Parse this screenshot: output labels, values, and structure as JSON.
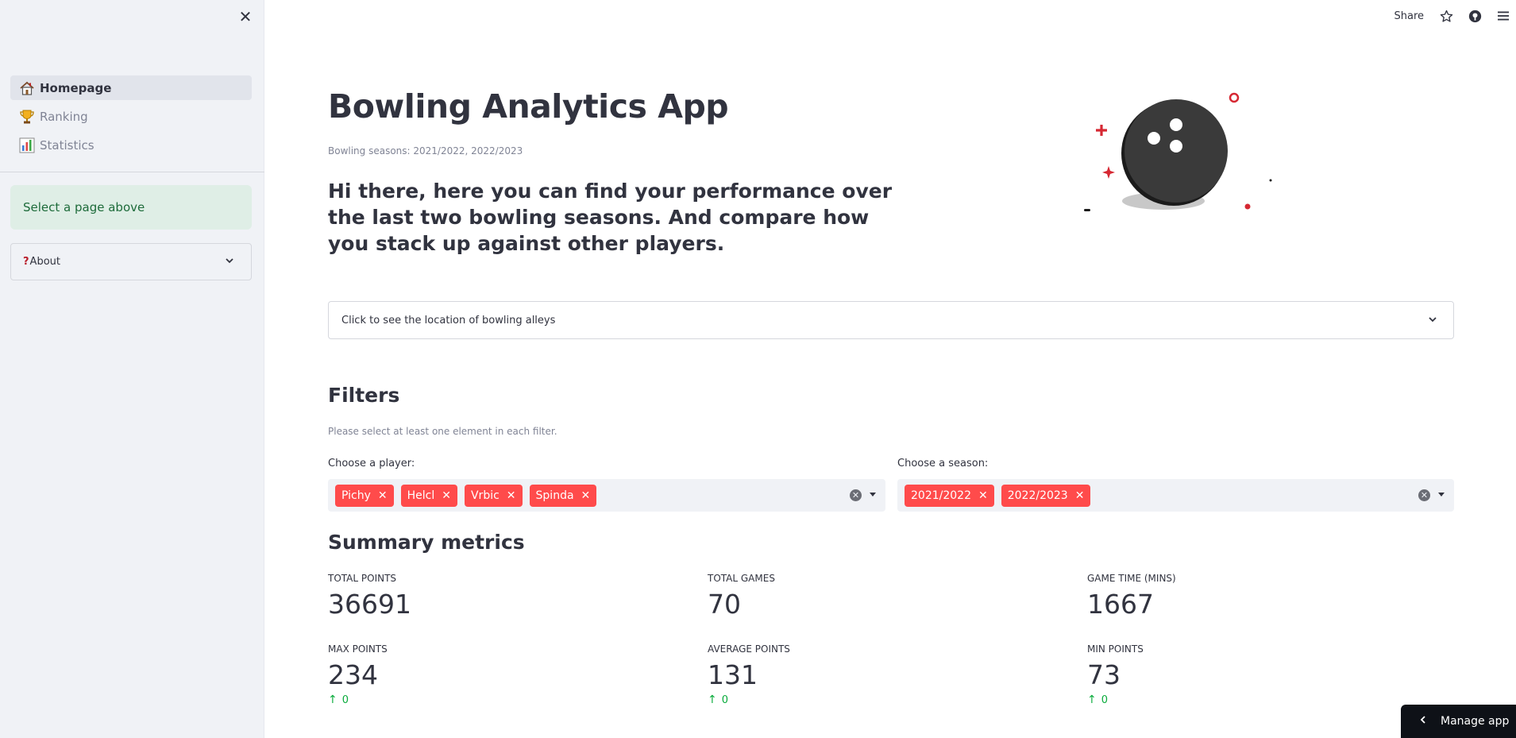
{
  "sidebar": {
    "items": [
      {
        "label": "Homepage",
        "icon": "house-icon"
      },
      {
        "label": "Ranking",
        "icon": "trophy-icon"
      },
      {
        "label": "Statistics",
        "icon": "bar-chart-icon"
      }
    ],
    "info": "Select a page above",
    "about_label": "About"
  },
  "toolbar": {
    "share_label": "Share"
  },
  "main": {
    "title": "Bowling Analytics App",
    "caption": "Bowling seasons: 2021/2022, 2022/2023",
    "intro": "Hi there, here you can find your performance over the last two bowling seasons. And compare how you stack up against other players.",
    "expander_label": "Click to see the location of bowling alleys"
  },
  "filters": {
    "heading": "Filters",
    "caption": "Please select at least one element in each filter.",
    "player_label": "Choose a player:",
    "players": [
      "Pichy",
      "Helcl",
      "Vrbic",
      "Spinda"
    ],
    "season_label": "Choose a season:",
    "seasons": [
      "2021/2022",
      "2022/2023"
    ]
  },
  "summary": {
    "heading": "Summary metrics",
    "metrics": [
      {
        "label": "TOTAL POINTS",
        "value": "36691"
      },
      {
        "label": "TOTAL GAMES",
        "value": "70"
      },
      {
        "label": "GAME TIME (MINS)",
        "value": "1667"
      },
      {
        "label": "MAX POINTS",
        "value": "234",
        "delta": "0"
      },
      {
        "label": "AVERAGE POINTS",
        "value": "131",
        "delta": "0"
      },
      {
        "label": "MIN POINTS",
        "value": "73",
        "delta": "0"
      }
    ]
  },
  "manage_app_label": "Manage app",
  "colors": {
    "accent": "#ff4b4b",
    "sidebar_bg": "#f0f2f6",
    "success": "#09ab3b"
  }
}
